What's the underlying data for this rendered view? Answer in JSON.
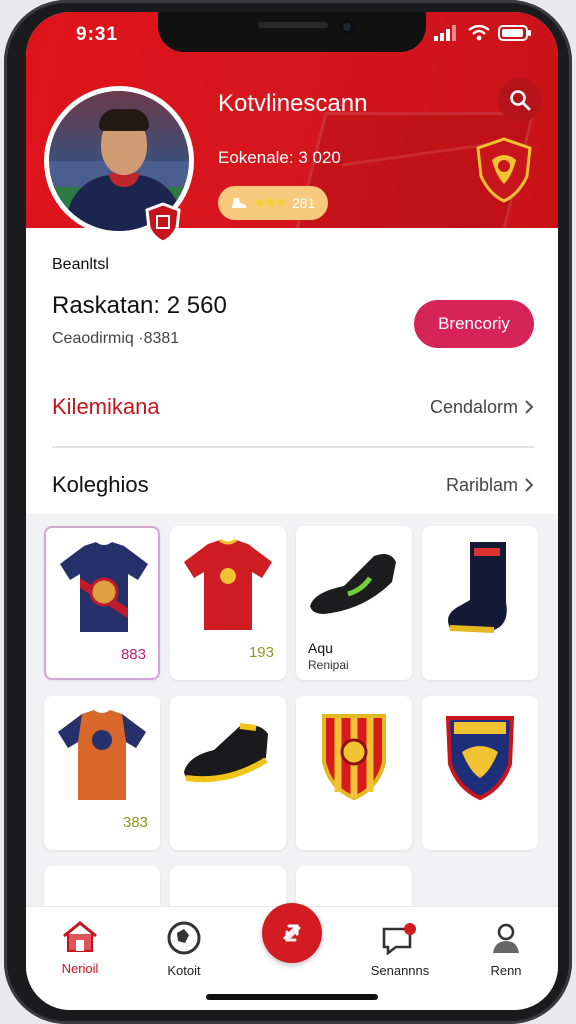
{
  "status": {
    "time": "9:31"
  },
  "profile": {
    "name": "Kotvlinescann",
    "subtitle": "Eokenale: 3 020",
    "rating_value": "281",
    "rating_stars": "★★★"
  },
  "info": {
    "section_label": "Beanltsl",
    "ranking": "Raskatan: 2 560",
    "ranking_sub": "Ceaodirmiq  ·8381",
    "cta_label": "Brencoriy"
  },
  "rows": [
    {
      "title": "Kilemikana",
      "link": "Cendalorm"
    },
    {
      "title": "Koleghios",
      "link": "Rariblam"
    }
  ],
  "products": [
    {
      "name": "",
      "sub": "",
      "price": "883",
      "price_color": "#c02070",
      "icon": "jersey-navy-icon",
      "selected": true
    },
    {
      "name": "",
      "sub": "",
      "price": "193",
      "price_color": "#8a9a1c",
      "icon": "jersey-red-icon",
      "selected": false
    },
    {
      "name": "Aqu",
      "sub": "Renipai",
      "price": "",
      "price_color": "#111",
      "icon": "cleat-black-icon",
      "selected": false
    },
    {
      "name": "",
      "sub": "",
      "price": "",
      "price_color": "#111",
      "icon": "boot-navy-icon",
      "selected": false
    },
    {
      "name": "",
      "sub": "",
      "price": "383",
      "price_color": "#8a9a1c",
      "icon": "jersey-orange-icon",
      "selected": false
    },
    {
      "name": "",
      "sub": "",
      "price": "",
      "price_color": "#111",
      "icon": "cleat-yellow-icon",
      "selected": false
    },
    {
      "name": "",
      "sub": "",
      "price": "",
      "price_color": "#111",
      "icon": "crest-red-icon",
      "selected": false
    },
    {
      "name": "",
      "sub": "",
      "price": "",
      "price_color": "#111",
      "icon": "crest-blue-icon",
      "selected": false
    }
  ],
  "tabs": [
    {
      "label": "Nerioil",
      "icon": "home-icon",
      "active": true
    },
    {
      "label": "Kotoit",
      "icon": "ball-icon",
      "active": false
    },
    {
      "label": "",
      "icon": "exchange-icon",
      "active": false
    },
    {
      "label": "Senannns",
      "icon": "chat-icon",
      "active": false
    },
    {
      "label": "Renn",
      "icon": "user-icon",
      "active": false
    }
  ],
  "colors": {
    "brand_red": "#d6161e",
    "cta_pink": "#d6245a"
  }
}
